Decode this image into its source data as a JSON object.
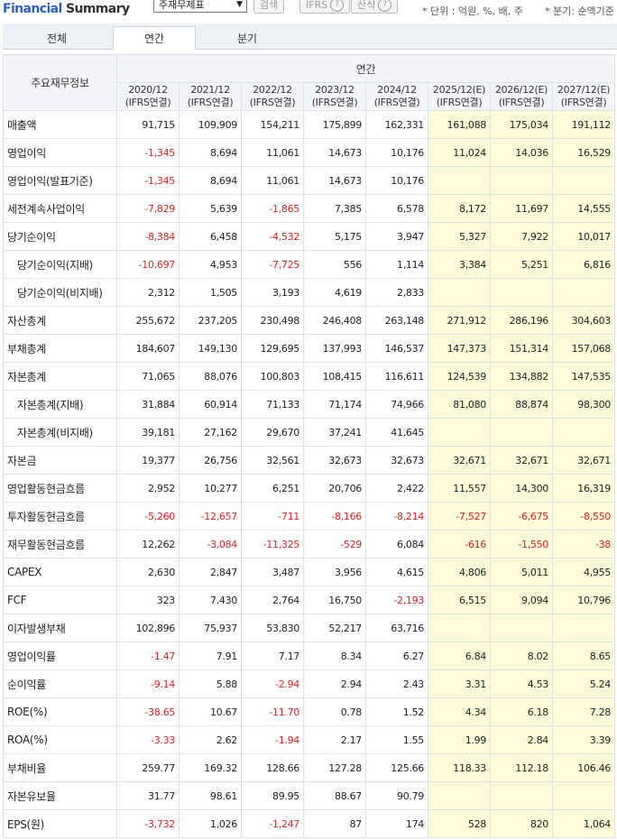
{
  "header": {
    "title_part1": "Financial",
    "title_part2": "Summary",
    "report_select": "주재무제표",
    "search_button": "검색",
    "ifrs_button": "IFRS",
    "formula_button": "산식",
    "unit_note": "* 단위 : 억원, %, 배, 주",
    "basis_note": "* 분기: 순액기준"
  },
  "tabs": [
    "전체",
    "연간",
    "분기"
  ],
  "active_tab": "연간",
  "table": {
    "corner_label": "주요재무정보",
    "group_label": "연간",
    "columns": [
      {
        "period": "2020/12",
        "basis": "(IFRS연결)",
        "estimate": false
      },
      {
        "period": "2021/12",
        "basis": "(IFRS연결)",
        "estimate": false
      },
      {
        "period": "2022/12",
        "basis": "(IFRS연결)",
        "estimate": false
      },
      {
        "period": "2023/12",
        "basis": "(IFRS연결)",
        "estimate": false
      },
      {
        "period": "2024/12",
        "basis": "(IFRS연결)",
        "estimate": false
      },
      {
        "period": "2025/12(E)",
        "basis": "(IFRS연결)",
        "estimate": true
      },
      {
        "period": "2026/12(E)",
        "basis": "(IFRS연결)",
        "estimate": true
      },
      {
        "period": "2027/12(E)",
        "basis": "(IFRS연결)",
        "estimate": true
      }
    ],
    "rows": [
      {
        "label": "매출액",
        "sub": false,
        "values": [
          "91,715",
          "109,909",
          "154,211",
          "175,899",
          "162,331",
          "161,088",
          "175,034",
          "191,112"
        ]
      },
      {
        "label": "영업이익",
        "sub": false,
        "values": [
          "-1,345",
          "8,694",
          "11,061",
          "14,673",
          "10,176",
          "11,024",
          "14,036",
          "16,529"
        ]
      },
      {
        "label": "영업이익(발표기준)",
        "sub": false,
        "values": [
          "-1,345",
          "8,694",
          "11,061",
          "14,673",
          "10,176",
          "",
          "",
          ""
        ]
      },
      {
        "label": "세전계속사업이익",
        "sub": false,
        "values": [
          "-7,829",
          "5,639",
          "-1,865",
          "7,385",
          "6,578",
          "8,172",
          "11,697",
          "14,555"
        ]
      },
      {
        "label": "당기순이익",
        "sub": false,
        "values": [
          "-8,384",
          "6,458",
          "-4,532",
          "5,175",
          "3,947",
          "5,327",
          "7,922",
          "10,017"
        ]
      },
      {
        "label": "당기순이익(지배)",
        "sub": true,
        "values": [
          "-10,697",
          "4,953",
          "-7,725",
          "556",
          "1,114",
          "3,384",
          "5,251",
          "6,816"
        ]
      },
      {
        "label": "당기순이익(비지배)",
        "sub": true,
        "values": [
          "2,312",
          "1,505",
          "3,193",
          "4,619",
          "2,833",
          "",
          "",
          ""
        ]
      },
      {
        "label": "자산총계",
        "sub": false,
        "values": [
          "255,672",
          "237,205",
          "230,498",
          "246,408",
          "263,148",
          "271,912",
          "286,196",
          "304,603"
        ]
      },
      {
        "label": "부채총계",
        "sub": false,
        "values": [
          "184,607",
          "149,130",
          "129,695",
          "137,993",
          "146,537",
          "147,373",
          "151,314",
          "157,068"
        ]
      },
      {
        "label": "자본총계",
        "sub": false,
        "values": [
          "71,065",
          "88,076",
          "100,803",
          "108,415",
          "116,611",
          "124,539",
          "134,882",
          "147,535"
        ]
      },
      {
        "label": "자본총계(지배)",
        "sub": true,
        "values": [
          "31,884",
          "60,914",
          "71,133",
          "71,174",
          "74,966",
          "81,080",
          "88,874",
          "98,300"
        ]
      },
      {
        "label": "자본총계(비지배)",
        "sub": true,
        "values": [
          "39,181",
          "27,162",
          "29,670",
          "37,241",
          "41,645",
          "",
          "",
          ""
        ]
      },
      {
        "label": "자본금",
        "sub": false,
        "values": [
          "19,377",
          "26,756",
          "32,561",
          "32,673",
          "32,673",
          "32,671",
          "32,671",
          "32,671"
        ]
      },
      {
        "label": "영업활동현금흐름",
        "sub": false,
        "values": [
          "2,952",
          "10,277",
          "6,251",
          "20,706",
          "2,422",
          "11,557",
          "14,300",
          "16,319"
        ]
      },
      {
        "label": "투자활동현금흐름",
        "sub": false,
        "values": [
          "-5,260",
          "-12,657",
          "-711",
          "-8,166",
          "-8,214",
          "-7,527",
          "-6,675",
          "-8,550"
        ]
      },
      {
        "label": "재무활동현금흐름",
        "sub": false,
        "values": [
          "12,262",
          "-3,084",
          "-11,325",
          "-529",
          "6,084",
          "-616",
          "-1,550",
          "-38"
        ]
      },
      {
        "label": "CAPEX",
        "sub": false,
        "values": [
          "2,630",
          "2,847",
          "3,487",
          "3,956",
          "4,615",
          "4,806",
          "5,011",
          "4,955"
        ]
      },
      {
        "label": "FCF",
        "sub": false,
        "values": [
          "323",
          "7,430",
          "2,764",
          "16,750",
          "-2,193",
          "6,515",
          "9,094",
          "10,796"
        ]
      },
      {
        "label": "이자발생부채",
        "sub": false,
        "values": [
          "102,896",
          "75,937",
          "53,830",
          "52,217",
          "63,716",
          "",
          "",
          ""
        ]
      },
      {
        "label": "영업이익률",
        "sub": false,
        "values": [
          "-1.47",
          "7.91",
          "7.17",
          "8.34",
          "6.27",
          "6.84",
          "8.02",
          "8.65"
        ]
      },
      {
        "label": "순이익률",
        "sub": false,
        "values": [
          "-9.14",
          "5.88",
          "-2.94",
          "2.94",
          "2.43",
          "3.31",
          "4.53",
          "5.24"
        ]
      },
      {
        "label": "ROE(%)",
        "sub": false,
        "values": [
          "-38.65",
          "10.67",
          "-11.70",
          "0.78",
          "1.52",
          "4.34",
          "6.18",
          "7.28"
        ]
      },
      {
        "label": "ROA(%)",
        "sub": false,
        "values": [
          "-3.33",
          "2.62",
          "-1.94",
          "2.17",
          "1.55",
          "1.99",
          "2.84",
          "3.39"
        ]
      },
      {
        "label": "부채비율",
        "sub": false,
        "values": [
          "259.77",
          "169.32",
          "128.66",
          "127.28",
          "125.66",
          "118.33",
          "112.18",
          "106.46"
        ]
      },
      {
        "label": "자본유보율",
        "sub": false,
        "values": [
          "31.77",
          "98.61",
          "89.95",
          "88.67",
          "90.79",
          "",
          "",
          ""
        ]
      },
      {
        "label": "EPS(원)",
        "sub": false,
        "values": [
          "-3,732",
          "1,026",
          "-1,247",
          "87",
          "174",
          "528",
          "820",
          "1,064"
        ]
      }
    ]
  },
  "colors": {
    "negative": "#e32121",
    "estimate_bg": "#fdfbd9",
    "brand_blue": "#2b61c8"
  }
}
